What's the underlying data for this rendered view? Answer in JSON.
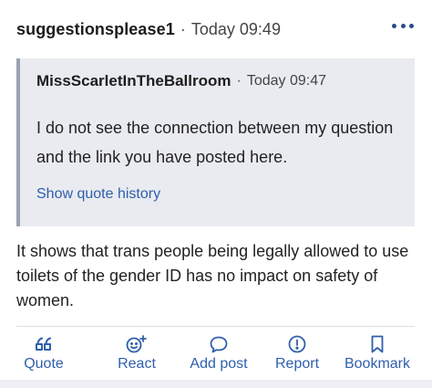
{
  "post": {
    "author": "suggestionsplease1",
    "separator": "·",
    "time": "Today 09:49",
    "body": "It shows that trans people being legally allowed to use toilets of the gender ID has no impact on safety of women."
  },
  "quote": {
    "author": "MissScarletInTheBallroom",
    "separator": "·",
    "time": "Today 09:47",
    "text": "I do not see the connection between my question and the link you have posted here.",
    "history_link": "Show quote history"
  },
  "actions": {
    "quote": {
      "label": "Quote",
      "icon": "quote-icon"
    },
    "react": {
      "label": "React",
      "icon": "emoji-plus-icon"
    },
    "add_post": {
      "label": "Add post",
      "icon": "speech-bubble-icon"
    },
    "report": {
      "label": "Report",
      "icon": "alert-circle-icon"
    },
    "bookmark": {
      "label": "Bookmark",
      "icon": "bookmark-icon"
    }
  },
  "colors": {
    "accent": "#2f5fab",
    "quote_bg": "#e9ebf0",
    "quote_border": "#9aa2b2",
    "more_dots": "#2a4a86"
  }
}
